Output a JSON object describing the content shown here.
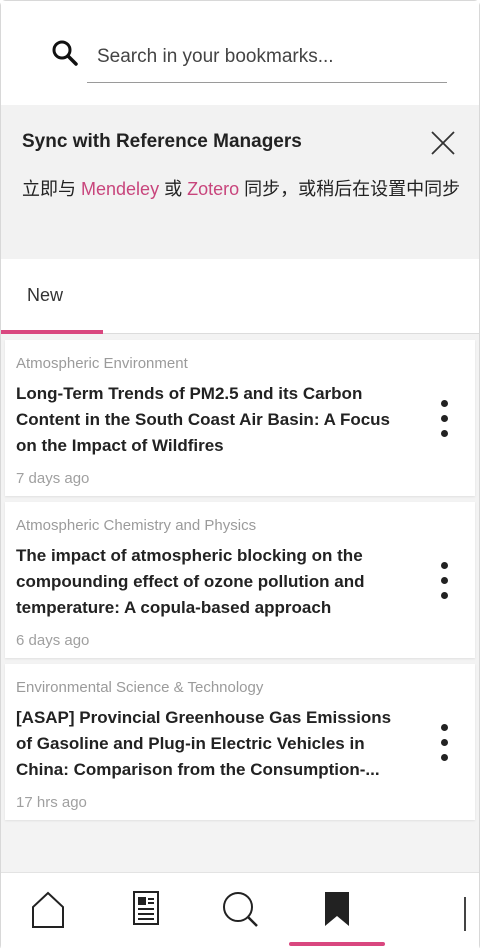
{
  "search": {
    "placeholder": "Search in your bookmarks..."
  },
  "sync": {
    "title": "Sync with Reference Managers",
    "text_prefix": "立即与 ",
    "link_mendeley": "Mendeley",
    "text_or": " 或 ",
    "link_zotero": "Zotero",
    "text_suffix": " 同步，或稍后在设置中同步"
  },
  "tabs": [
    {
      "label": "New",
      "active": true
    }
  ],
  "articles": [
    {
      "source": "Atmospheric Environment",
      "title": "Long-Term Trends of PM2.5 and its Carbon Content in the South Coast Air Basin: A Focus on the Impact of Wildfires",
      "time": "7 days ago"
    },
    {
      "source": "Atmospheric Chemistry and Physics",
      "title": "The impact of atmospheric blocking on the compounding effect of ozone pollution and temperature: A copula-based approach",
      "time": "6 days ago"
    },
    {
      "source": "Environmental Science & Technology",
      "title": "[ASAP] Provincial Greenhouse Gas Emissions of Gasoline and Plug-in Electric Vehicles in China: Comparison from the Consumption-...",
      "time": "17 hrs ago"
    }
  ],
  "nav": {
    "items": [
      "home-icon",
      "news-icon",
      "search-icon",
      "bookmark-icon"
    ],
    "active": "bookmark-icon",
    "accent": "#d9477f"
  },
  "colors": {
    "accent": "#d9477f",
    "link": "#c8457c",
    "banner_bg": "#f2f2f2"
  }
}
